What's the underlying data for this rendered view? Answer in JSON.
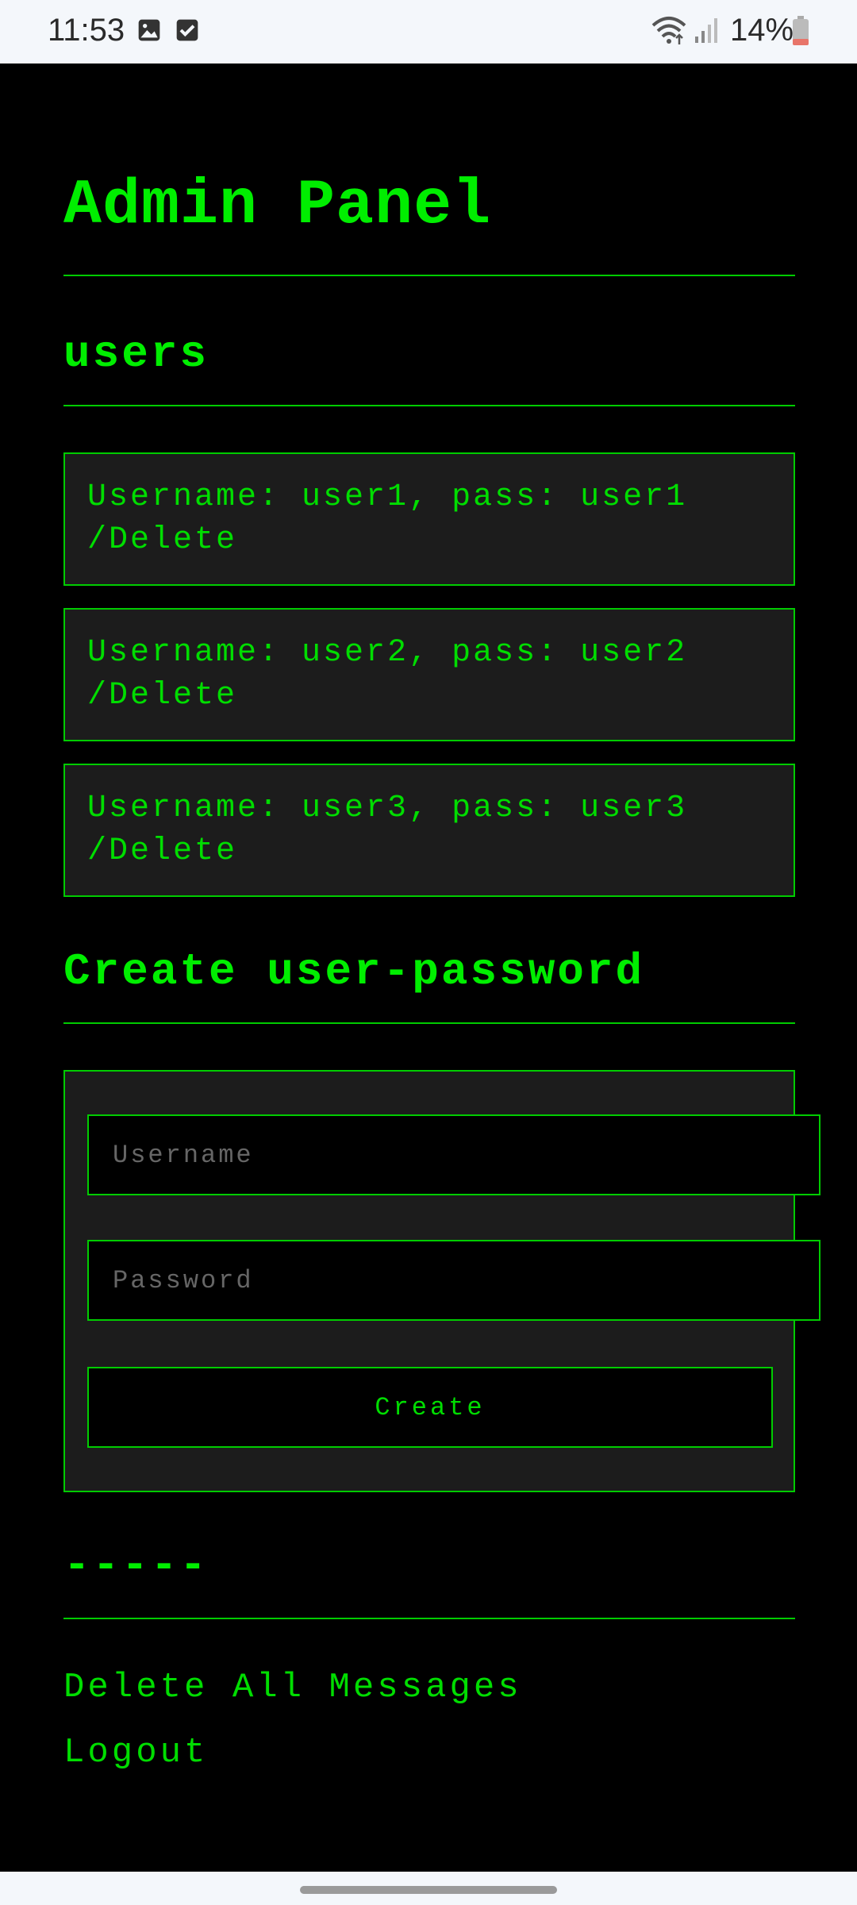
{
  "status_bar": {
    "time": "11:53",
    "battery_percent": "14%",
    "icons": [
      "gallery-icon",
      "checkbox-icon",
      "wifi-icon",
      "signal-icon",
      "battery-icon"
    ]
  },
  "page": {
    "title": "Admin Panel",
    "users_heading": "users",
    "users": [
      {
        "line1": "Username: user1, pass: user1",
        "line2": "/Delete"
      },
      {
        "line1": "Username: user2, pass: user2",
        "line2": "/Delete"
      },
      {
        "line1": "Username: user3, pass: user3",
        "line2": "/Delete"
      }
    ],
    "create_heading": "Create user-password",
    "form": {
      "username_placeholder": "Username",
      "password_placeholder": "Password",
      "create_label": "Create"
    },
    "separator_heading": "-----",
    "links": {
      "delete_all": "Delete All Messages",
      "logout": "Logout"
    }
  },
  "colors": {
    "accent": "#00ee00",
    "background": "#000000",
    "card": "#1c1c1c",
    "status_bar": "#f4f7fb"
  }
}
